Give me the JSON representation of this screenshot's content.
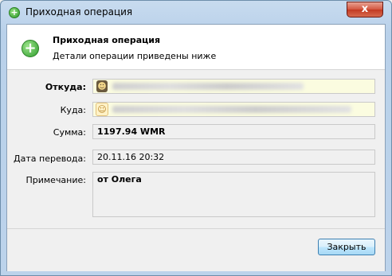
{
  "window": {
    "title": "Приходная операция",
    "close_glyph": "x",
    "title_icon": "green-plus-icon"
  },
  "header": {
    "title": "Приходная операция",
    "subtitle": "Детали операции приведены ниже",
    "icon": "green-plus-icon"
  },
  "fields": {
    "from_label": "Откуда:",
    "to_label": "Куда:",
    "amount_label": "Сумма:",
    "amount_value": "1197.94 WMR",
    "date_label": "Дата перевода:",
    "date_value": "20.11.16 20:32",
    "note_label": "Примечание:",
    "note_value": "от Олега"
  },
  "footer": {
    "close_button": "Закрыть"
  },
  "colors": {
    "from_field_bg": "#fbfce0",
    "accent_green": "#2f9d2d"
  }
}
